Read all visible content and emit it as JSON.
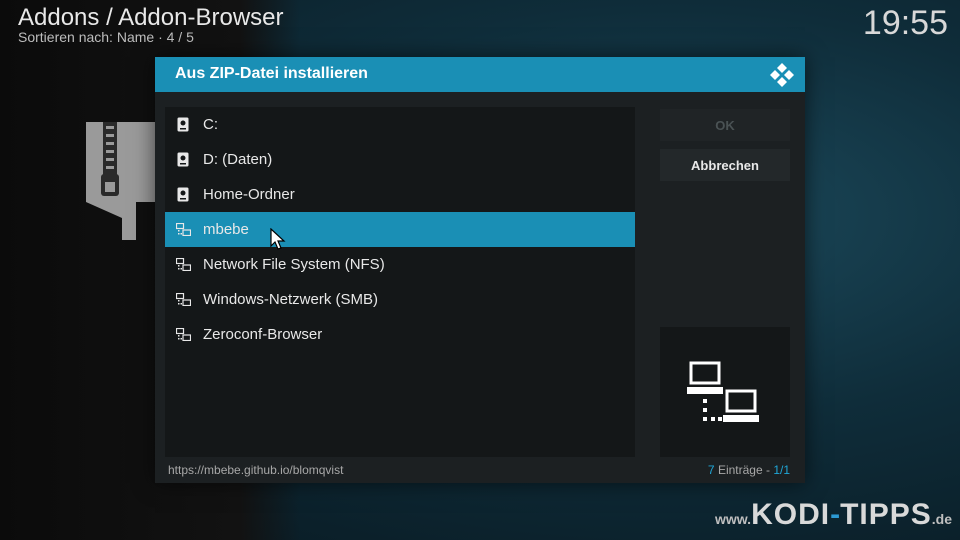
{
  "header": {
    "title": "Addons / Addon-Browser",
    "subtitle": "Sortieren nach: Name  ·  4 / 5",
    "clock": "19:55"
  },
  "dialog": {
    "title": "Aus ZIP-Datei installieren",
    "items": [
      {
        "label": "C:",
        "icon": "drive-icon",
        "selected": false
      },
      {
        "label": "D: (Daten)",
        "icon": "drive-icon",
        "selected": false
      },
      {
        "label": "Home-Ordner",
        "icon": "drive-icon",
        "selected": false
      },
      {
        "label": "mbebe",
        "icon": "network-icon",
        "selected": true
      },
      {
        "label": "Network File System (NFS)",
        "icon": "network-icon",
        "selected": false
      },
      {
        "label": "Windows-Netzwerk (SMB)",
        "icon": "network-icon",
        "selected": false
      },
      {
        "label": "Zeroconf-Browser",
        "icon": "network-icon",
        "selected": false
      }
    ],
    "buttons": {
      "ok_label": "OK",
      "cancel_label": "Abbrechen"
    },
    "footer": {
      "path": "https://mbebe.github.io/blomqvist",
      "count_number": "7",
      "count_text": " Einträge - ",
      "page": "1/1"
    }
  },
  "watermark": {
    "www": "www.",
    "kodi": "KODI",
    "dash": "-",
    "tipps": "TIPPS",
    "de": ".de"
  },
  "colors": {
    "accent": "#1a8fb5",
    "dialog_bg": "#1c2022",
    "list_bg": "#141718"
  }
}
